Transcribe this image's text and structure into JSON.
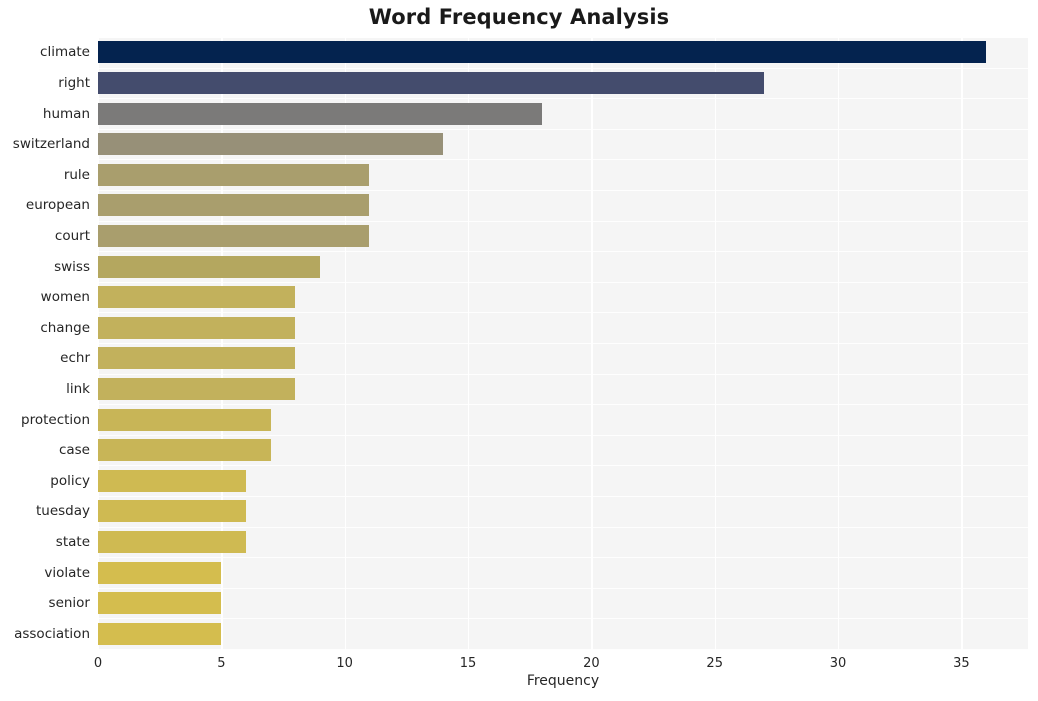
{
  "chart_data": {
    "type": "bar",
    "orientation": "horizontal",
    "title": "Word Frequency Analysis",
    "xlabel": "Frequency",
    "ylabel": "",
    "categories": [
      "climate",
      "right",
      "human",
      "switzerland",
      "rule",
      "european",
      "court",
      "swiss",
      "women",
      "change",
      "echr",
      "link",
      "protection",
      "case",
      "policy",
      "tuesday",
      "state",
      "violate",
      "senior",
      "association"
    ],
    "values": [
      36,
      27,
      18,
      14,
      11,
      11,
      11,
      9,
      8,
      8,
      8,
      8,
      7,
      7,
      6,
      6,
      6,
      5,
      5,
      5
    ],
    "bar_colors": [
      "#04234f",
      "#444c6d",
      "#7b7a79",
      "#979078",
      "#a99e6d",
      "#a99e6d",
      "#a99e6d",
      "#b4a75f",
      "#c2b15c",
      "#c2b15c",
      "#c2b15c",
      "#c2b15c",
      "#c8b557",
      "#c8b557",
      "#cfba52",
      "#cfba52",
      "#cfba52",
      "#d4bd4e",
      "#d4bd4e",
      "#d4bd4e"
    ],
    "xticks": [
      0,
      5,
      10,
      15,
      20,
      25,
      30,
      35
    ],
    "xlim": [
      0,
      37.7
    ],
    "grid": true,
    "grid_color": "#ffffff",
    "plot_background": "#f5f5f5",
    "figure_background": "#ffffff",
    "title_color": "#1a1a1a",
    "tick_label_color": "#262626"
  }
}
